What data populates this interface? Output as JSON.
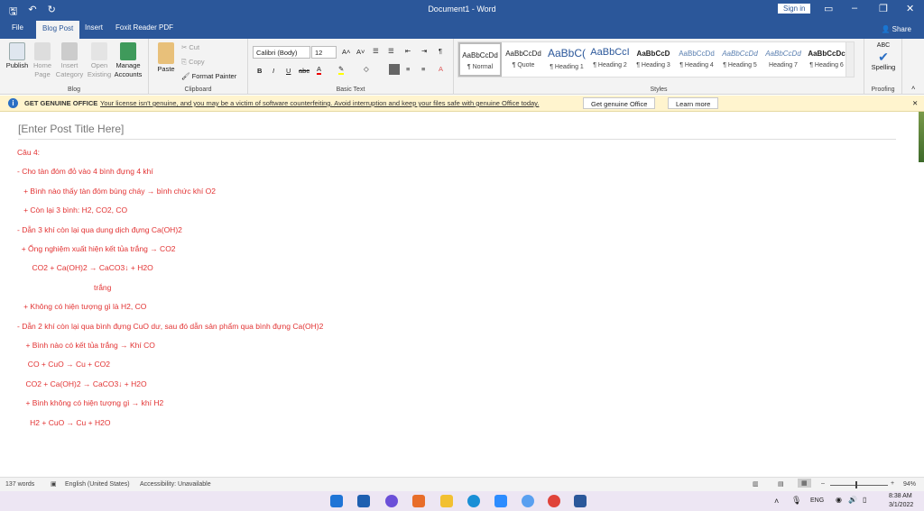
{
  "window": {
    "title": "Document1  -  Word",
    "sign_in": "Sign in",
    "share": "Share"
  },
  "tabs": [
    "File",
    "Blog Post",
    "Insert",
    "Foxit Reader PDF"
  ],
  "ribbon": {
    "blog": {
      "label": "Blog",
      "buttons": [
        "Publish",
        "Home Page",
        "Insert Category",
        "Open Existing",
        "Manage Accounts"
      ]
    },
    "clipboard": {
      "label": "Clipboard",
      "paste": "Paste",
      "cut": "Cut",
      "copy": "Copy",
      "format_painter": "Format Painter"
    },
    "basic_text": {
      "label": "Basic Text",
      "font": "Calibri (Body)",
      "size": "12",
      "bold": "B",
      "italic": "I",
      "underline": "U",
      "strike": "abc"
    },
    "styles": {
      "label": "Styles",
      "items": [
        {
          "preview": "AaBbCcDd",
          "name": "¶ Normal"
        },
        {
          "preview": "AaBbCcDd",
          "name": "¶ Quote"
        },
        {
          "preview": "AaBbC(",
          "name": "¶ Heading 1"
        },
        {
          "preview": "AaBbCcI",
          "name": "¶ Heading 2"
        },
        {
          "preview": "AaBbCcD",
          "name": "¶ Heading 3"
        },
        {
          "preview": "AaBbCcDd",
          "name": "¶ Heading 4"
        },
        {
          "preview": "AaBbCcDd",
          "name": "¶ Heading 5"
        },
        {
          "preview": "AaBbCcDd",
          "name": "Heading 7"
        },
        {
          "preview": "AaBbCcDc",
          "name": "¶ Heading 6"
        }
      ]
    },
    "proofing": {
      "label": "Proofing",
      "spelling": "Spelling",
      "abc": "ABC"
    }
  },
  "infobar": {
    "heading": "GET GENUINE OFFICE",
    "message": "Your license isn't genuine, and you may be a victim of software counterfeiting. Avoid interruption and keep your files safe with genuine Office today.",
    "btn1": "Get genuine Office",
    "btn2": "Learn more"
  },
  "document": {
    "post_title": "[Enter Post Title Here]",
    "lines": [
      "Câu 4:",
      "- Cho tàn đóm đỏ vào 4 bình đựng 4 khí",
      "   + Bình nào thấy tàn đóm bùng cháy → bình chức khí O2",
      "   + Còn lại 3 bình: H2, CO2, CO",
      "- Dẫn 3 khí còn lại qua dung dịch đựng Ca(OH)2",
      "  + Ống nghiệm xuất hiện kết tủa trắng → CO2",
      "       CO2 + Ca(OH)2 → CaCO3↓ + H2O",
      "                                    trắng",
      "   + Không có hiện tượng gì là H2, CO",
      "- Dẫn 2 khí còn lại qua bình đựng CuO dư, sau đó dẫn sản phẩm qua bình đựng Ca(OH)2",
      "    + Bình nào có kết tủa trắng → Khí CO",
      "     CO + CuO → Cu + CO2",
      "    CO2 + Ca(OH)2 → CaCO3↓ + H2O",
      "    + Bình không có hiện tượng gì → khí H2",
      "      H2 + CuO → Cu + H2O"
    ]
  },
  "status": {
    "words": "137 words",
    "language": "English (United States)",
    "accessibility": "Accessibility: Unavailable",
    "zoom": "94%"
  },
  "taskbar": {
    "lang": "ENG",
    "time": "8:38 AM",
    "date": "3/1/2022"
  }
}
